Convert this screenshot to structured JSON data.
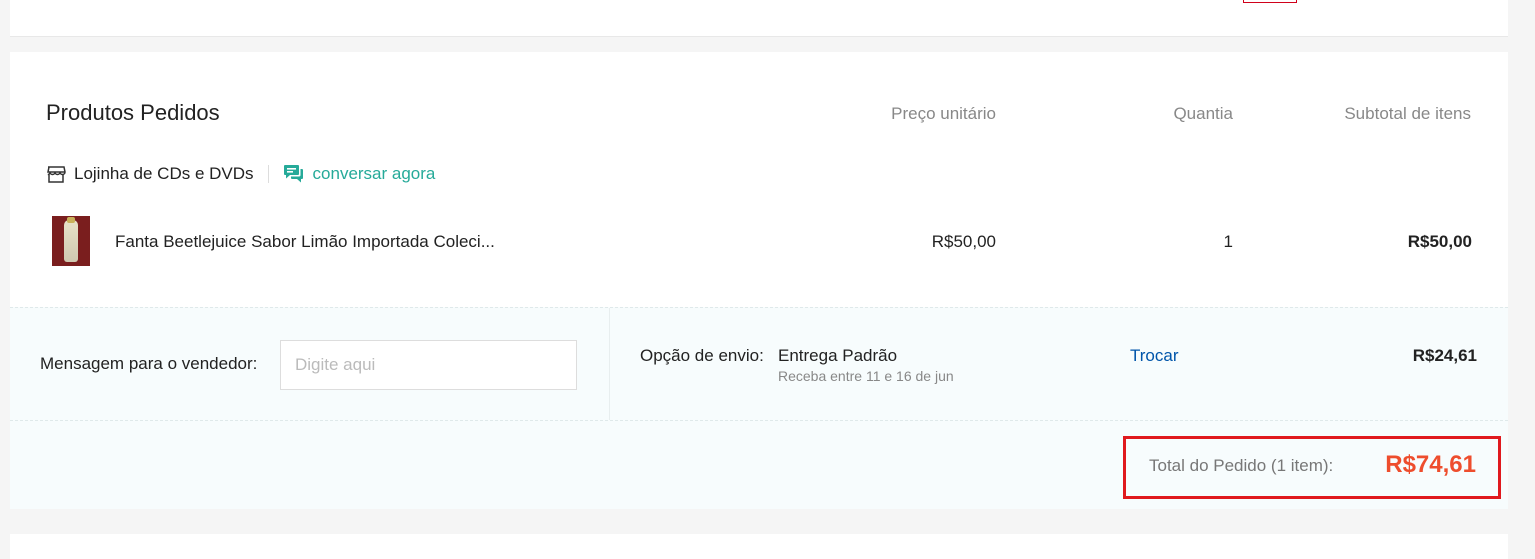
{
  "section": {
    "title": "Produtos Pedidos",
    "columns": {
      "unit_price": "Preço unitário",
      "quantity": "Quantia",
      "subtotal": "Subtotal de itens"
    }
  },
  "shop": {
    "name": "Lojinha de CDs e DVDs",
    "chat_label": "conversar agora",
    "shop_icon": "store-icon",
    "chat_icon": "chat-icon",
    "chat_color": "#26aa99"
  },
  "product": {
    "name": "Fanta Beetlejuice Sabor Limão Importada Coleci...",
    "unit_price": "R$50,00",
    "quantity": "1",
    "subtotal": "R$50,00"
  },
  "message": {
    "label": "Mensagem para o vendedor:",
    "placeholder": "Digite aqui"
  },
  "shipping": {
    "label": "Opção de envio:",
    "option": "Entrega Padrão",
    "window": "Receba entre 11 e 16 de jun",
    "change_label": "Trocar",
    "price": "R$24,61"
  },
  "total": {
    "label": "Total do Pedido (1 item):",
    "value": "R$74,61",
    "value_color": "#ee4d2d",
    "highlight_color": "#e0191e"
  }
}
